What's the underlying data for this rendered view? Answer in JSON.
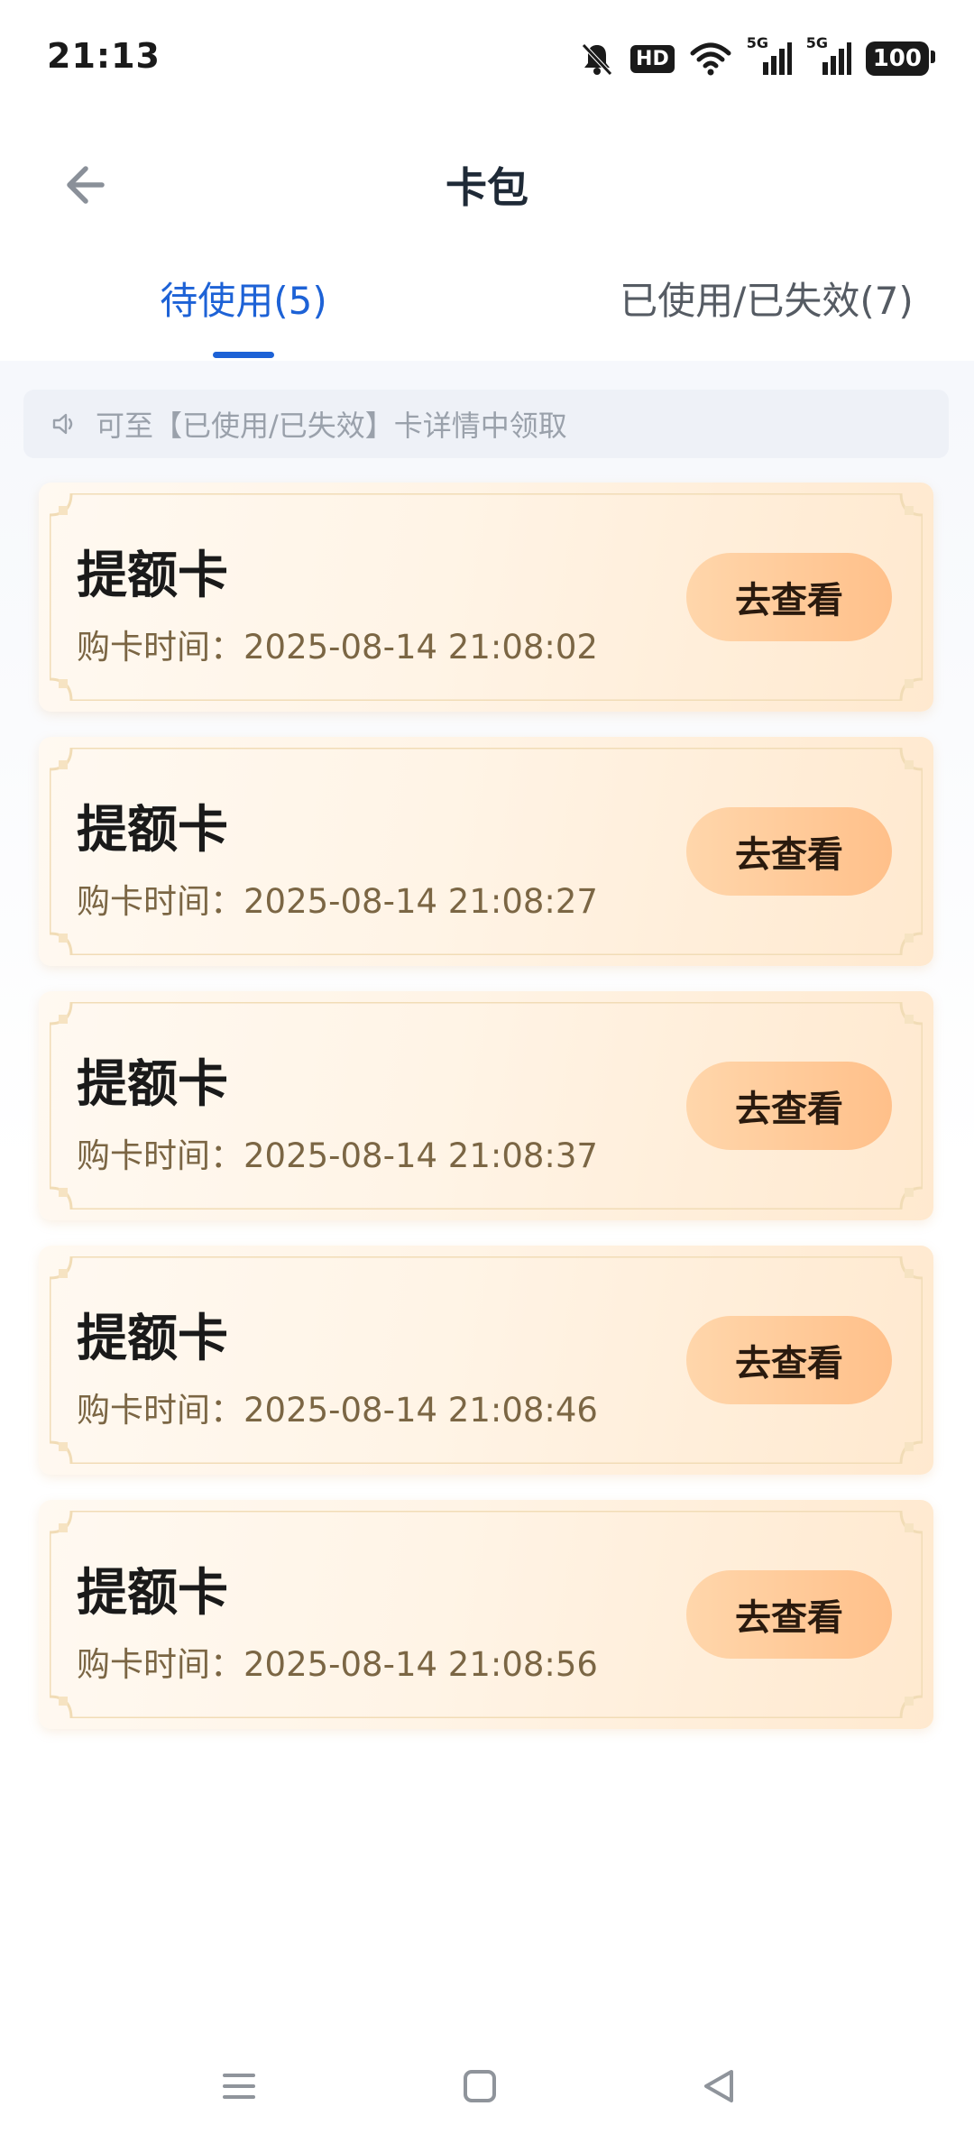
{
  "status_bar": {
    "time": "21:13",
    "hd_label": "HD",
    "sim1_label": "5G",
    "sim2_label": "5G",
    "battery": "100"
  },
  "header": {
    "title": "卡包"
  },
  "tabs": [
    {
      "label": "待使用(5)",
      "active": true
    },
    {
      "label": "已使用/已失效(7)",
      "active": false
    }
  ],
  "notice": {
    "text": "可至【已使用/已失效】卡详情中领取"
  },
  "cards": [
    {
      "title": "提额卡",
      "time": "购卡时间：2025-08-14 21:08:02",
      "button": "去查看"
    },
    {
      "title": "提额卡",
      "time": "购卡时间：2025-08-14 21:08:27",
      "button": "去查看"
    },
    {
      "title": "提额卡",
      "time": "购卡时间：2025-08-14 21:08:37",
      "button": "去查看"
    },
    {
      "title": "提额卡",
      "time": "购卡时间：2025-08-14 21:08:46",
      "button": "去查看"
    },
    {
      "title": "提额卡",
      "time": "购卡时间：2025-08-14 21:08:56",
      "button": "去查看"
    }
  ],
  "colors": {
    "accent": "#1d62d6",
    "card_button": "#ffc08a",
    "card_time": "#7b6644"
  },
  "icons": {
    "back": "arrow-left-icon",
    "notice": "speaker-icon",
    "nav_menu": "menu-icon",
    "nav_home": "home-square-icon",
    "nav_back": "triangle-back-icon"
  }
}
